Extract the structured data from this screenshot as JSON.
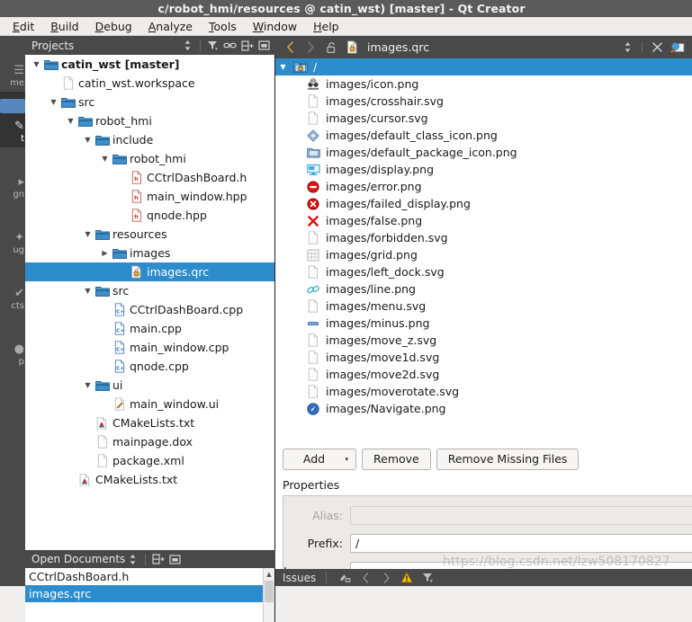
{
  "window": {
    "title": "c/robot_hmi/resources @ catin_wst) [master] - Qt Creator"
  },
  "menubar": {
    "items": [
      {
        "label": "Edit",
        "accel": "E"
      },
      {
        "label": "Build",
        "accel": "B"
      },
      {
        "label": "Debug",
        "accel": "D"
      },
      {
        "label": "Analyze",
        "accel": "A"
      },
      {
        "label": "Tools",
        "accel": "T"
      },
      {
        "label": "Window",
        "accel": "W"
      },
      {
        "label": "Help",
        "accel": "H"
      }
    ]
  },
  "modebar": {
    "items": [
      {
        "label": "me",
        "icon": "welcome-icon",
        "selected": false
      },
      {
        "label": "t",
        "icon": "edit-icon",
        "selected": true
      },
      {
        "label": "gn",
        "icon": "design-icon",
        "selected": false
      },
      {
        "label": "ug",
        "icon": "debug-icon",
        "selected": false
      },
      {
        "label": "cts",
        "icon": "projects-icon",
        "selected": false
      },
      {
        "label": "p",
        "icon": "help-icon",
        "selected": false
      }
    ]
  },
  "projects_dock": {
    "title": "Projects",
    "toolbar": [
      {
        "name": "sync-selection-icon"
      },
      {
        "name": "filter-icon"
      },
      {
        "name": "link-icon"
      },
      {
        "name": "split-icon"
      },
      {
        "name": "close-dock-icon"
      }
    ],
    "tree": [
      {
        "depth": 0,
        "twist": "down",
        "icon": "folder-icon",
        "label": "catin_wst [master]",
        "bold": true,
        "selected": false
      },
      {
        "depth": 1,
        "twist": "none",
        "icon": "file-icon",
        "label": "catin_wst.workspace",
        "bold": false,
        "selected": false
      },
      {
        "depth": 1,
        "twist": "down",
        "icon": "folder-icon",
        "label": "src",
        "bold": false,
        "selected": false
      },
      {
        "depth": 2,
        "twist": "down",
        "icon": "folder-icon",
        "label": "robot_hmi",
        "bold": false,
        "selected": false
      },
      {
        "depth": 3,
        "twist": "down",
        "icon": "folder-icon",
        "label": "include",
        "bold": false,
        "selected": false
      },
      {
        "depth": 4,
        "twist": "down",
        "icon": "folder-icon",
        "label": "robot_hmi",
        "bold": false,
        "selected": false
      },
      {
        "depth": 5,
        "twist": "none",
        "icon": "header-file-icon",
        "label": "CCtrlDashBoard.h",
        "bold": false,
        "selected": false
      },
      {
        "depth": 5,
        "twist": "none",
        "icon": "header-file-icon",
        "label": "main_window.hpp",
        "bold": false,
        "selected": false
      },
      {
        "depth": 5,
        "twist": "none",
        "icon": "header-file-icon",
        "label": "qnode.hpp",
        "bold": false,
        "selected": false
      },
      {
        "depth": 3,
        "twist": "down",
        "icon": "folder-icon",
        "label": "resources",
        "bold": false,
        "selected": false
      },
      {
        "depth": 4,
        "twist": "right",
        "icon": "folder-icon",
        "label": "images",
        "bold": false,
        "selected": false
      },
      {
        "depth": 5,
        "twist": "none",
        "icon": "qrc-file-icon",
        "label": "images.qrc",
        "bold": false,
        "selected": true
      },
      {
        "depth": 3,
        "twist": "down",
        "icon": "folder-icon",
        "label": "src",
        "bold": false,
        "selected": false
      },
      {
        "depth": 4,
        "twist": "none",
        "icon": "cpp-file-icon",
        "label": "CCtrlDashBoard.cpp",
        "bold": false,
        "selected": false
      },
      {
        "depth": 4,
        "twist": "none",
        "icon": "cpp-file-icon",
        "label": "main.cpp",
        "bold": false,
        "selected": false
      },
      {
        "depth": 4,
        "twist": "none",
        "icon": "cpp-file-icon",
        "label": "main_window.cpp",
        "bold": false,
        "selected": false
      },
      {
        "depth": 4,
        "twist": "none",
        "icon": "cpp-file-icon",
        "label": "qnode.cpp",
        "bold": false,
        "selected": false
      },
      {
        "depth": 3,
        "twist": "down",
        "icon": "folder-icon",
        "label": "ui",
        "bold": false,
        "selected": false
      },
      {
        "depth": 4,
        "twist": "none",
        "icon": "ui-file-icon",
        "label": "main_window.ui",
        "bold": false,
        "selected": false
      },
      {
        "depth": 3,
        "twist": "none",
        "icon": "cmake-file-icon",
        "label": "CMakeLists.txt",
        "bold": false,
        "selected": false
      },
      {
        "depth": 3,
        "twist": "none",
        "icon": "file-icon",
        "label": "mainpage.dox",
        "bold": false,
        "selected": false
      },
      {
        "depth": 3,
        "twist": "none",
        "icon": "file-icon",
        "label": "package.xml",
        "bold": false,
        "selected": false
      },
      {
        "depth": 2,
        "twist": "none",
        "icon": "cmake-file-icon",
        "label": "CMakeLists.txt",
        "bold": false,
        "selected": false
      }
    ]
  },
  "open_documents": {
    "title": "Open Documents",
    "toolbar": [
      {
        "name": "sync-selection-icon"
      },
      {
        "name": "split-icon"
      },
      {
        "name": "close-dock-icon"
      }
    ],
    "items": [
      {
        "label": "CCtrlDashBoard.h",
        "selected": false
      },
      {
        "label": "images.qrc",
        "selected": true
      }
    ]
  },
  "editor": {
    "toolbar": {
      "back_icon": "back-arrow-icon",
      "forward_icon": "forward-arrow-icon",
      "lock_icon": "unlocked-icon",
      "file_icon": "qrc-file-icon",
      "filename": "images.qrc",
      "selector_icon": "updown-arrow-icon",
      "close_icon": "close-icon",
      "split_icon": "split-editor-icon"
    },
    "resource_tree": {
      "prefix_row": {
        "label": "/",
        "icon": "qrc-prefix-icon",
        "twist": "down",
        "selected": true
      },
      "files": [
        {
          "label": "images/icon.png",
          "icon": "ros-logo-icon"
        },
        {
          "label": "images/crosshair.svg",
          "icon": "blank-file-icon"
        },
        {
          "label": "images/cursor.svg",
          "icon": "blank-file-icon"
        },
        {
          "label": "images/default_class_icon.png",
          "icon": "diamond-icon"
        },
        {
          "label": "images/default_package_icon.png",
          "icon": "folder-blue-icon"
        },
        {
          "label": "images/display.png",
          "icon": "display-icon"
        },
        {
          "label": "images/error.png",
          "icon": "error-circle-icon"
        },
        {
          "label": "images/failed_display.png",
          "icon": "failed-display-icon"
        },
        {
          "label": "images/false.png",
          "icon": "red-x-icon"
        },
        {
          "label": "images/forbidden.svg",
          "icon": "blank-file-icon"
        },
        {
          "label": "images/grid.png",
          "icon": "grid-icon"
        },
        {
          "label": "images/left_dock.svg",
          "icon": "blank-file-icon"
        },
        {
          "label": "images/line.png",
          "icon": "link-chain-icon"
        },
        {
          "label": "images/menu.svg",
          "icon": "blank-file-icon"
        },
        {
          "label": "images/minus.png",
          "icon": "minus-icon"
        },
        {
          "label": "images/move_z.svg",
          "icon": "blank-file-icon"
        },
        {
          "label": "images/move1d.svg",
          "icon": "blank-file-icon"
        },
        {
          "label": "images/move2d.svg",
          "icon": "blank-file-icon"
        },
        {
          "label": "images/moverotate.svg",
          "icon": "blank-file-icon"
        },
        {
          "label": "images/Navigate.png",
          "icon": "navigate-icon"
        }
      ]
    },
    "buttons": {
      "add": "Add",
      "add_caret": "▾",
      "remove": "Remove",
      "remove_missing": "Remove Missing Files"
    },
    "properties": {
      "section_label": "Properties",
      "fields": [
        {
          "label": "Alias:",
          "value": "",
          "disabled": true
        },
        {
          "label": "Prefix:",
          "value": "/",
          "disabled": false
        },
        {
          "label": "Language:",
          "value": "",
          "disabled": false
        }
      ]
    }
  },
  "statusbar": {
    "issues_label": "Issues",
    "icons": [
      {
        "name": "filter-build-icon"
      },
      {
        "name": "prev-issue-icon"
      },
      {
        "name": "next-issue-icon"
      },
      {
        "name": "warning-icon"
      },
      {
        "name": "issues-filter-icon"
      }
    ]
  },
  "watermark": {
    "text": "https://blog.csdn.net/lzw508170827"
  },
  "colors": {
    "selection_blue": "#2d8ccb",
    "dark_chrome": "#494949",
    "titlebar": "#5b5b5b",
    "panel_bg": "#eceae7"
  }
}
